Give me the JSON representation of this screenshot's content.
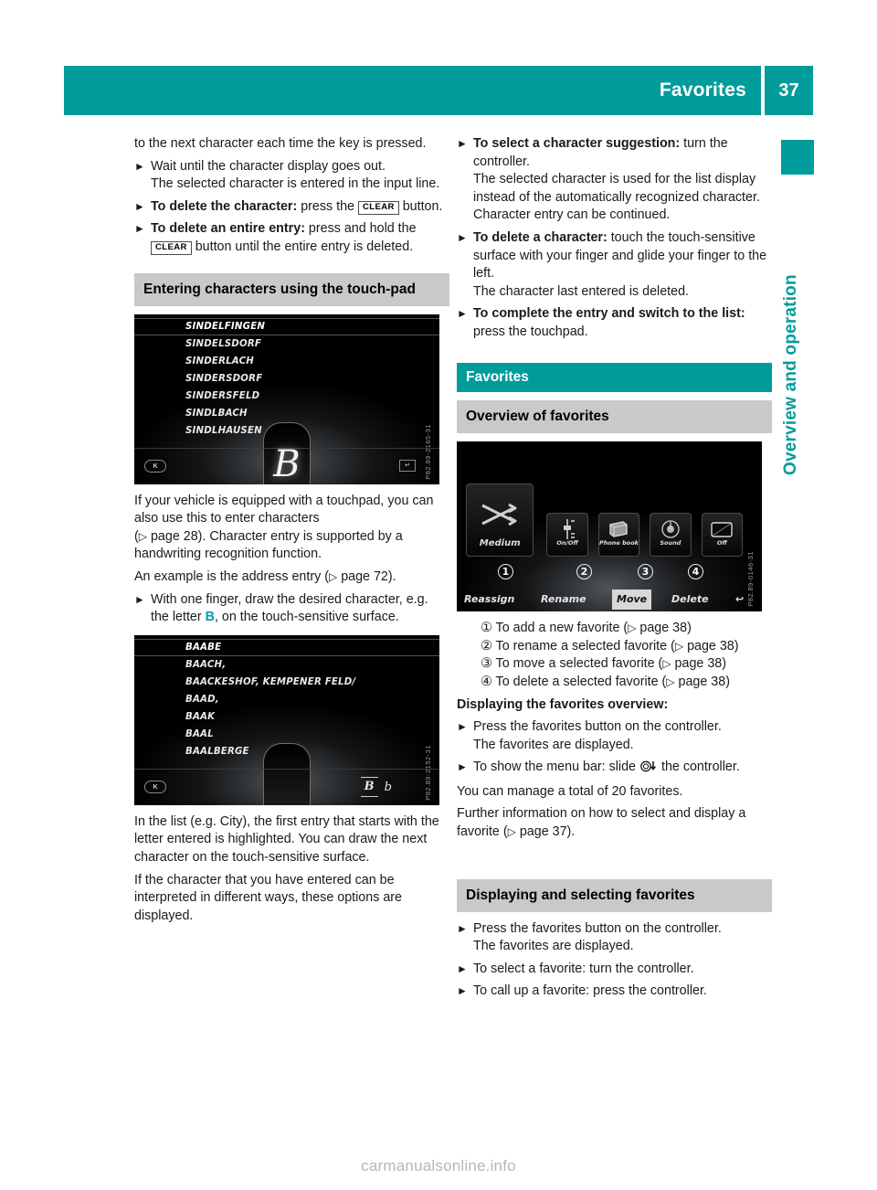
{
  "header": {
    "title": "Favorites",
    "page_number": "37",
    "accent_color": "#009b9b"
  },
  "side_tab": {
    "label": "Overview and operation"
  },
  "left_column": {
    "intro_continuation": "to the next character each time the key is pressed.",
    "steps": [
      {
        "bold": "",
        "text": "Wait until the character display goes out.",
        "sub": "The selected character is entered in the input line."
      },
      {
        "bold": "To delete the character:",
        "text_before_key": " press the ",
        "key": "CLEAR",
        "text_after_key": " button."
      },
      {
        "bold": "To delete an entire entry:",
        "text_before_key": " press and hold the ",
        "key": "CLEAR",
        "text_after_key": " button until the entire entry is deleted."
      }
    ],
    "section_heading": "Entering characters using the touch-pad",
    "figure1": {
      "code": "P82.89-2165-31",
      "list_items": [
        "SINDELFINGEN",
        "SINDELSDORF",
        "SINDERLACH",
        "SINDERSDORF",
        "SINDERSFELD",
        "SINDLBACH",
        "SINDLHAUSEN"
      ],
      "handwritten_char": "B",
      "back_button": "K",
      "ok_button": "↵"
    },
    "para_touchpad_1": "If your vehicle is equipped with a touchpad, you can also use this to enter characters",
    "para_touchpad_2_pre": "(",
    "para_touchpad_2_ref": "page 28",
    "para_touchpad_2_post": "). Character entry is supported by a handwriting recognition function.",
    "para_example_pre": "An example is the address entry (",
    "para_example_ref": "page 72",
    "para_example_post": ").",
    "step_draw_pre": "With one finger, draw the desired character, e.g. the letter ",
    "step_draw_letter": "B",
    "step_draw_post": ", on the touch-sensitive surface.",
    "figure2": {
      "code": "P82.89-2152-31",
      "list_items": [
        "BAABE",
        "BAACH,",
        "BAACKESHOF, KEMPENER FELD/",
        "BAAD,",
        "BAAK",
        "BAAL",
        "BAALBERGE"
      ],
      "char_option_primary": "B",
      "char_option_secondary": "b",
      "back_button": "K"
    },
    "para_list_highlight": "In the list (e.g. City), the first entry that starts with the letter entered is highlighted. You can draw the next character on the touch-sensitive surface.",
    "para_interpretation": "If the character that you have entered can be interpreted in different ways, these options are displayed."
  },
  "right_column": {
    "steps_top": [
      {
        "bold": "To select a character suggestion:",
        "text": " turn the controller.",
        "sub": "The selected character is used for the list display instead of the automatically recognized character. Character entry can be continued."
      },
      {
        "bold": "To delete a character:",
        "text": " touch the touch-sensitive surface with your finger and glide your finger to the left.",
        "sub": "The character last entered is deleted."
      },
      {
        "bold": "To complete the entry and switch to the list:",
        "text": " press the touchpad.",
        "sub": ""
      }
    ],
    "chapter_heading": "Favorites",
    "section_heading": "Overview of favorites",
    "figure3": {
      "code": "P82.89-0146-31",
      "tiles": [
        {
          "label": "Medium",
          "icon": "shuffle-icon"
        },
        {
          "label": "On/Off",
          "icon": "slider-icon"
        },
        {
          "label": "Phone book",
          "icon": "phonebook-icon"
        },
        {
          "label": "Sound",
          "icon": "sound-dial-icon"
        },
        {
          "label": "Off",
          "icon": "display-off-icon"
        }
      ],
      "callout_numbers": [
        "1",
        "2",
        "3",
        "4"
      ],
      "menu_items": [
        "Reassign",
        "Rename",
        "Move",
        "Delete"
      ],
      "menu_active": "Move",
      "back_arrow": "↩"
    },
    "callouts": [
      {
        "num": "①",
        "text_pre": "To add a new favorite (",
        "ref": "page 38",
        "text_post": ")"
      },
      {
        "num": "②",
        "text_pre": "To rename a selected favorite (",
        "ref": "page 38",
        "text_post": ")"
      },
      {
        "num": "③",
        "text_pre": "To move a selected favorite (",
        "ref": "page 38",
        "text_post": ")"
      },
      {
        "num": "④",
        "text_pre": "To delete a selected favorite (",
        "ref": "page 38",
        "text_post": ")"
      }
    ],
    "sub_heading_displaying": "Displaying the favorites overview:",
    "steps_displaying": [
      {
        "text": "Press the favorites button on the controller.",
        "sub": "The favorites are displayed."
      },
      {
        "text_pre": "To show the menu bar: slide ",
        "glyph": "controller-down-icon",
        "text_post": " the controller.",
        "sub": ""
      }
    ],
    "para_total": "You can manage a total of 20 favorites.",
    "para_further_pre": "Further information on how to select and display a favorite (",
    "para_further_ref": "page 37",
    "para_further_post": ").",
    "section_heading_2": "Displaying and selecting favorites",
    "steps_selecting": [
      {
        "text": "Press the favorites button on the controller.",
        "sub": "The favorites are displayed."
      },
      {
        "text": "To select a favorite: turn the controller.",
        "sub": ""
      },
      {
        "text": "To call up a favorite: press the controller.",
        "sub": ""
      }
    ]
  },
  "watermark": "carmanualsonline.info"
}
